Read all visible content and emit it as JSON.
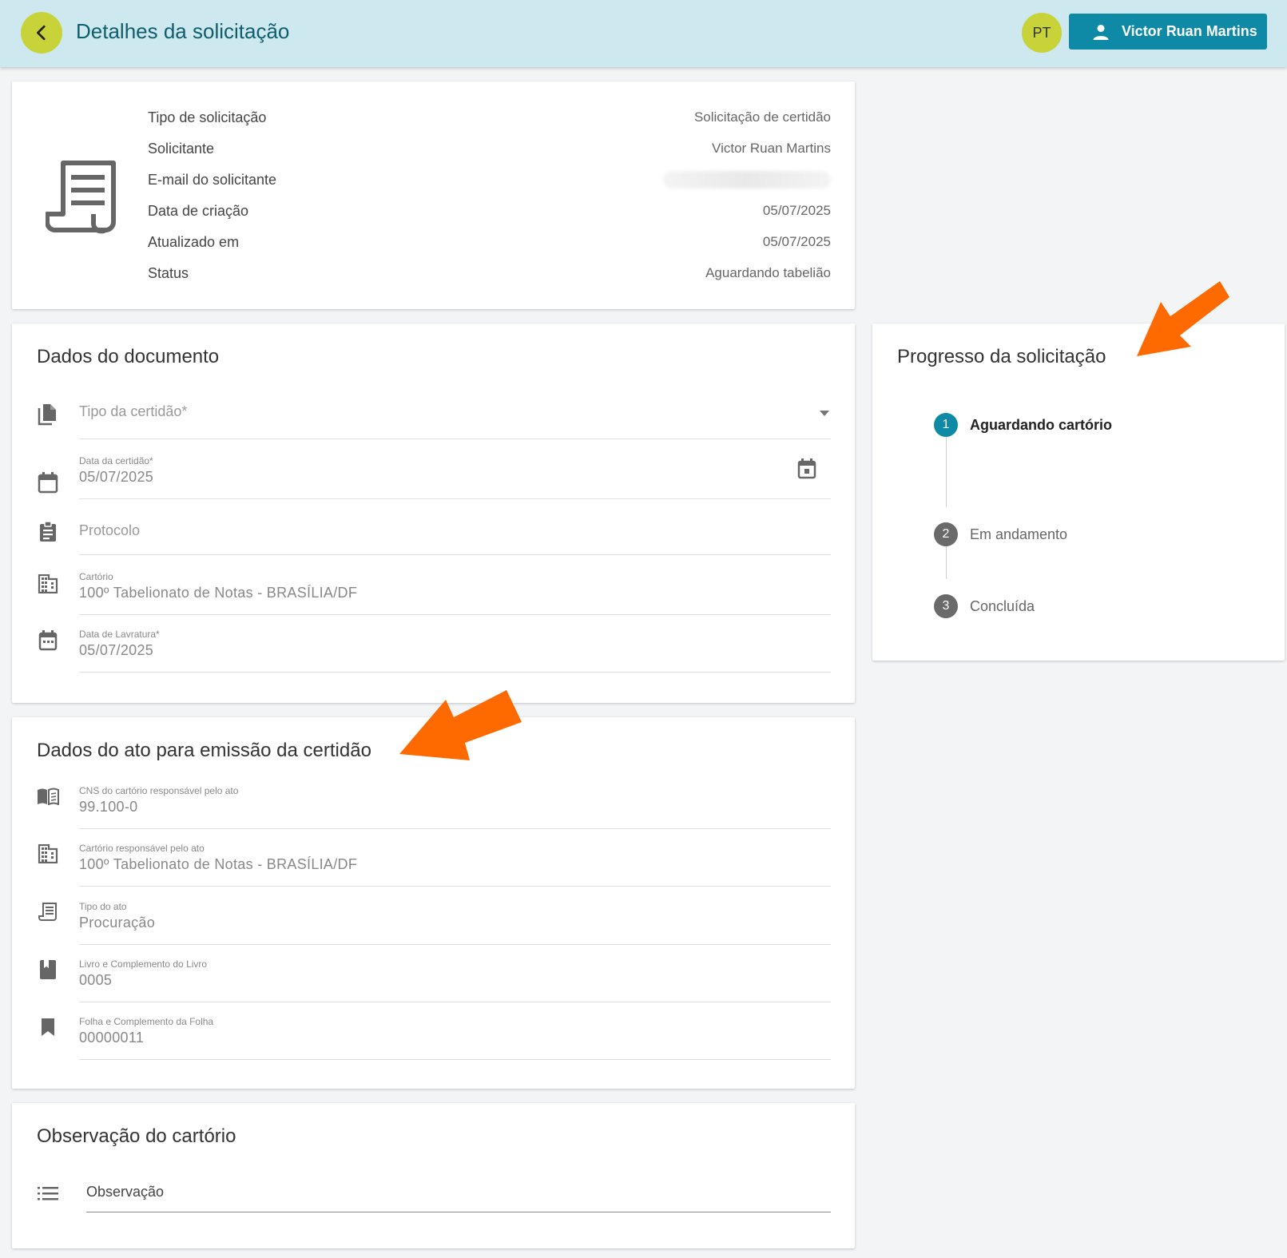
{
  "header": {
    "title": "Detalhes da solicitação",
    "lang_badge": "PT",
    "user_name": "Victor Ruan Martins"
  },
  "summary": {
    "rows": [
      {
        "label": "Tipo de solicitação",
        "value": "Solicitação de certidão"
      },
      {
        "label": "Solicitante",
        "value": "Victor Ruan Martins"
      },
      {
        "label": "E-mail do solicitante",
        "value": ""
      },
      {
        "label": "Data de criação",
        "value": "05/07/2025"
      },
      {
        "label": "Atualizado em",
        "value": "05/07/2025"
      },
      {
        "label": "Status",
        "value": "Aguardando tabelião"
      }
    ]
  },
  "documento": {
    "title": "Dados do documento",
    "tipo_certidao": {
      "placeholder": "Tipo da certidão*"
    },
    "data_certidao": {
      "label": "Data da certidão*",
      "value": "05/07/2025"
    },
    "protocolo": {
      "placeholder": "Protocolo"
    },
    "cartorio": {
      "label": "Cartório",
      "value": "100º Tabelionato de Notas - BRASÍLIA/DF"
    },
    "data_lavratura": {
      "label": "Data de Lavratura*",
      "value": "05/07/2025"
    }
  },
  "ato": {
    "title": "Dados do ato para emissão da certidão",
    "cns": {
      "label": "CNS do cartório responsável pelo ato",
      "value": "99.100-0"
    },
    "cartorio": {
      "label": "Cartório responsável pelo ato",
      "value": "100º Tabelionato de Notas - BRASÍLIA/DF"
    },
    "tipo_ato": {
      "label": "Tipo do ato",
      "value": "Procuração"
    },
    "livro": {
      "label": "Livro e Complemento do Livro",
      "value": "0005"
    },
    "folha": {
      "label": "Folha e Complemento da Folha",
      "value": "00000011"
    }
  },
  "observacao": {
    "title": "Observação do cartório",
    "placeholder": "Observação"
  },
  "progress": {
    "title": "Progresso da solicitação",
    "steps": [
      {
        "num": "1",
        "label": "Aguardando cartório"
      },
      {
        "num": "2",
        "label": "Em andamento"
      },
      {
        "num": "3",
        "label": "Concluída"
      }
    ]
  },
  "colors": {
    "header_bg": "#cde9ef",
    "accent": "#0e8aa6",
    "lime": "#c8d33a",
    "arrow": "#ff6a00"
  }
}
